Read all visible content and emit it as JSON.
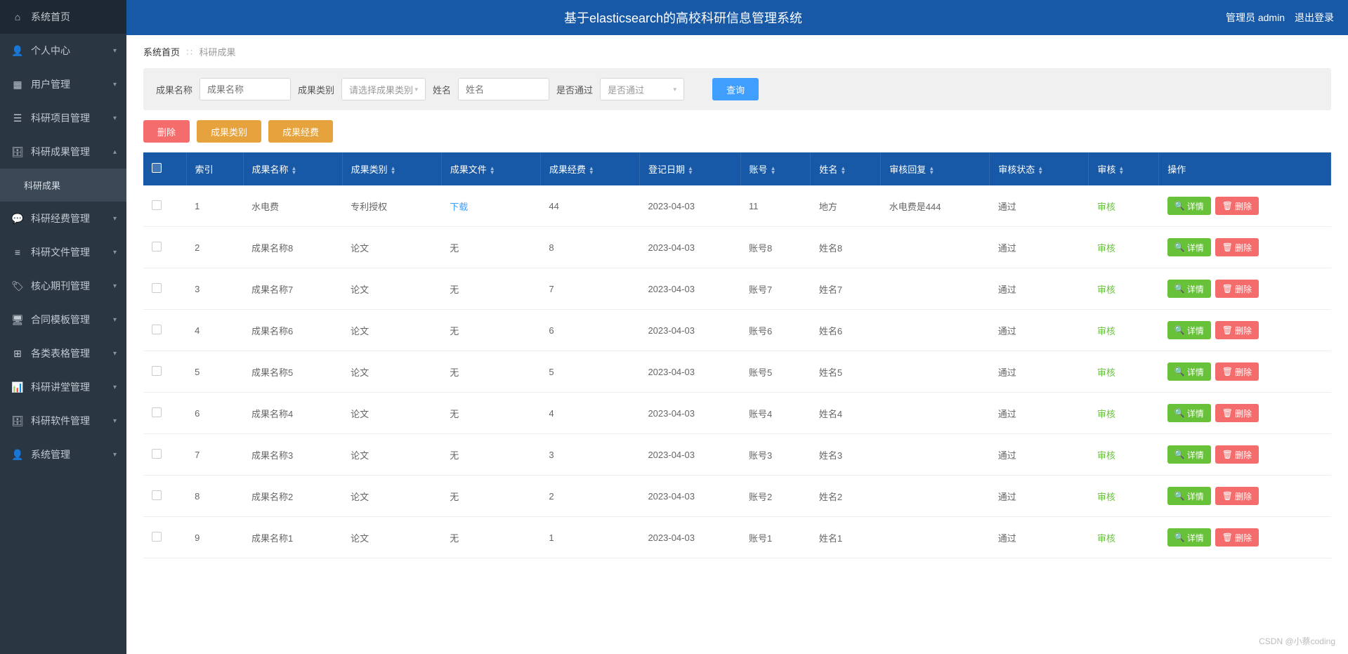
{
  "header": {
    "title": "基于elasticsearch的高校科研信息管理系统",
    "role_user": "管理员 admin",
    "logout": "退出登录"
  },
  "sidebar": {
    "items": [
      {
        "icon": "home",
        "label": "系统首页",
        "expandable": false
      },
      {
        "icon": "user",
        "label": "个人中心",
        "expandable": true,
        "chev": "▾"
      },
      {
        "icon": "grid",
        "label": "用户管理",
        "expandable": true,
        "chev": "▾"
      },
      {
        "icon": "list",
        "label": "科研项目管理",
        "expandable": true,
        "chev": "▾"
      },
      {
        "icon": "case",
        "label": "科研成果管理",
        "expandable": true,
        "chev": "▴"
      },
      {
        "icon": "",
        "label": "科研成果",
        "sub": true
      },
      {
        "icon": "chat",
        "label": "科研经费管理",
        "expandable": true,
        "chev": "▾"
      },
      {
        "icon": "menu",
        "label": "科研文件管理",
        "expandable": true,
        "chev": "▾"
      },
      {
        "icon": "tags",
        "label": "核心期刊管理",
        "expandable": true,
        "chev": "▾"
      },
      {
        "icon": "monitor",
        "label": "合同模板管理",
        "expandable": true,
        "chev": "▾"
      },
      {
        "icon": "grid4",
        "label": "各类表格管理",
        "expandable": true,
        "chev": "▾"
      },
      {
        "icon": "bars",
        "label": "科研讲堂管理",
        "expandable": true,
        "chev": "▾"
      },
      {
        "icon": "case",
        "label": "科研软件管理",
        "expandable": true,
        "chev": "▾"
      },
      {
        "icon": "user",
        "label": "系统管理",
        "expandable": true,
        "chev": "▾"
      }
    ]
  },
  "breadcrumb": {
    "home": "系统首页",
    "current": "科研成果"
  },
  "filters": {
    "name_label": "成果名称",
    "name_placeholder": "成果名称",
    "type_label": "成果类别",
    "type_placeholder": "请选择成果类别",
    "person_label": "姓名",
    "person_placeholder": "姓名",
    "pass_label": "是否通过",
    "pass_placeholder": "是否通过",
    "search_btn": "查询"
  },
  "actions": {
    "delete": "删除",
    "type": "成果类别",
    "fund": "成果经费"
  },
  "table": {
    "columns": [
      "索引",
      "成果名称",
      "成果类别",
      "成果文件",
      "成果经费",
      "登记日期",
      "账号",
      "姓名",
      "审核回复",
      "审核状态",
      "审核",
      "操作"
    ],
    "detail_btn": "详情",
    "delete_btn": "删除",
    "audit_link": "审核",
    "download_link": "下载",
    "rows": [
      {
        "idx": "1",
        "name": "水电费",
        "type": "专利授权",
        "file": "下载",
        "fund": "44",
        "date": "2023-04-03",
        "acc": "11",
        "person": "地方",
        "reply": "水电费是444",
        "status": "通过"
      },
      {
        "idx": "2",
        "name": "成果名称8",
        "type": "论文",
        "file": "无",
        "fund": "8",
        "date": "2023-04-03",
        "acc": "账号8",
        "person": "姓名8",
        "reply": "",
        "status": "通过"
      },
      {
        "idx": "3",
        "name": "成果名称7",
        "type": "论文",
        "file": "无",
        "fund": "7",
        "date": "2023-04-03",
        "acc": "账号7",
        "person": "姓名7",
        "reply": "",
        "status": "通过"
      },
      {
        "idx": "4",
        "name": "成果名称6",
        "type": "论文",
        "file": "无",
        "fund": "6",
        "date": "2023-04-03",
        "acc": "账号6",
        "person": "姓名6",
        "reply": "",
        "status": "通过"
      },
      {
        "idx": "5",
        "name": "成果名称5",
        "type": "论文",
        "file": "无",
        "fund": "5",
        "date": "2023-04-03",
        "acc": "账号5",
        "person": "姓名5",
        "reply": "",
        "status": "通过"
      },
      {
        "idx": "6",
        "name": "成果名称4",
        "type": "论文",
        "file": "无",
        "fund": "4",
        "date": "2023-04-03",
        "acc": "账号4",
        "person": "姓名4",
        "reply": "",
        "status": "通过"
      },
      {
        "idx": "7",
        "name": "成果名称3",
        "type": "论文",
        "file": "无",
        "fund": "3",
        "date": "2023-04-03",
        "acc": "账号3",
        "person": "姓名3",
        "reply": "",
        "status": "通过"
      },
      {
        "idx": "8",
        "name": "成果名称2",
        "type": "论文",
        "file": "无",
        "fund": "2",
        "date": "2023-04-03",
        "acc": "账号2",
        "person": "姓名2",
        "reply": "",
        "status": "通过"
      },
      {
        "idx": "9",
        "name": "成果名称1",
        "type": "论文",
        "file": "无",
        "fund": "1",
        "date": "2023-04-03",
        "acc": "账号1",
        "person": "姓名1",
        "reply": "",
        "status": "通过"
      }
    ]
  },
  "watermark": "CSDN @小蔡coding",
  "icons": {
    "home": "⌂",
    "user": "👤",
    "grid": "▦",
    "list": "☰",
    "case": "🗄",
    "chat": "💬",
    "menu": "≡",
    "tags": "🏷",
    "monitor": "🖥",
    "grid4": "⊞",
    "bars": "📊",
    "search": "🔍",
    "trash": "🗑"
  }
}
